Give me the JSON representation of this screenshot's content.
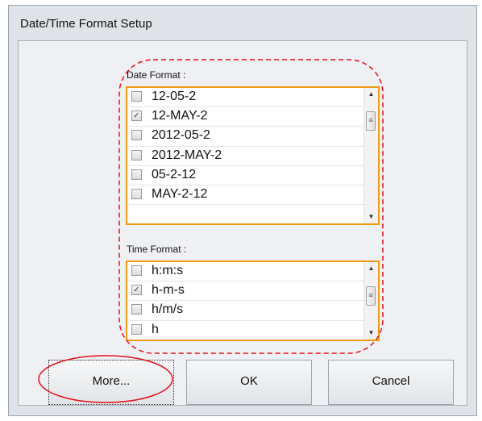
{
  "window": {
    "title": "Date/Time Format Setup"
  },
  "date_format": {
    "label": "Date Format :",
    "options": [
      {
        "text": "12-05-2",
        "checked": false
      },
      {
        "text": "12-MAY-2",
        "checked": true
      },
      {
        "text": "2012-05-2",
        "checked": false
      },
      {
        "text": "2012-MAY-2",
        "checked": false
      },
      {
        "text": "05-2-12",
        "checked": false
      },
      {
        "text": "MAY-2-12",
        "checked": false
      }
    ]
  },
  "time_format": {
    "label": "Time Format :",
    "options": [
      {
        "text": "h:m:s",
        "checked": false
      },
      {
        "text": "h-m-s",
        "checked": true
      },
      {
        "text": "h/m/s",
        "checked": false
      },
      {
        "text": "h",
        "checked": false
      }
    ]
  },
  "buttons": {
    "more": "More...",
    "ok": "OK",
    "cancel": "Cancel"
  },
  "colors": {
    "highlight_border": "#f09a16",
    "annotation": "#e8101a"
  }
}
